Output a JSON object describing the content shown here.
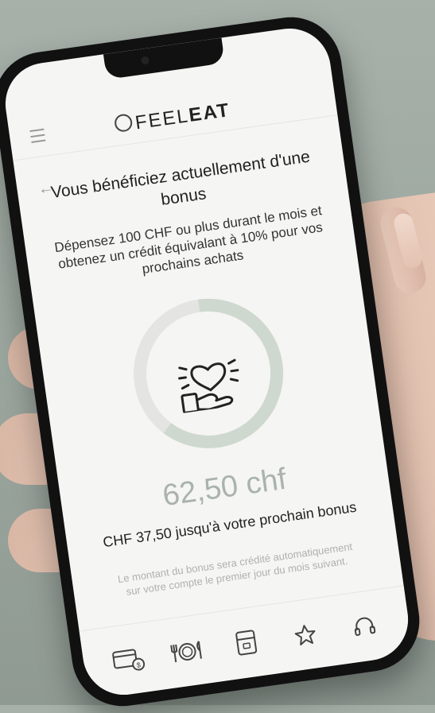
{
  "header": {
    "logo_light": "FEEL",
    "logo_bold": "EAT"
  },
  "bonus": {
    "title": "Vous bénéficiez actuellement d'une bonus",
    "description": "Dépensez 100 CHF ou plus durant le mois et obtenez un crédit équivalant à 10% pour vos prochains achats",
    "progress_percent": 62.5,
    "current_amount": "62,50 chf",
    "remaining_text": "CHF 37,50 jusqu'à votre prochain bonus",
    "note": "Le montant du bonus sera crédité automatiquement sur votre compte le premier jour du mois suivant."
  },
  "tabbar": {
    "icons": [
      "wallet-icon",
      "restaurant-icon",
      "fridge-icon",
      "star-icon",
      "support-icon"
    ]
  },
  "colors": {
    "ring_progress": "#cfd8cf",
    "ring_track": "#e4e4e2",
    "amount": "#a9b3ab"
  }
}
